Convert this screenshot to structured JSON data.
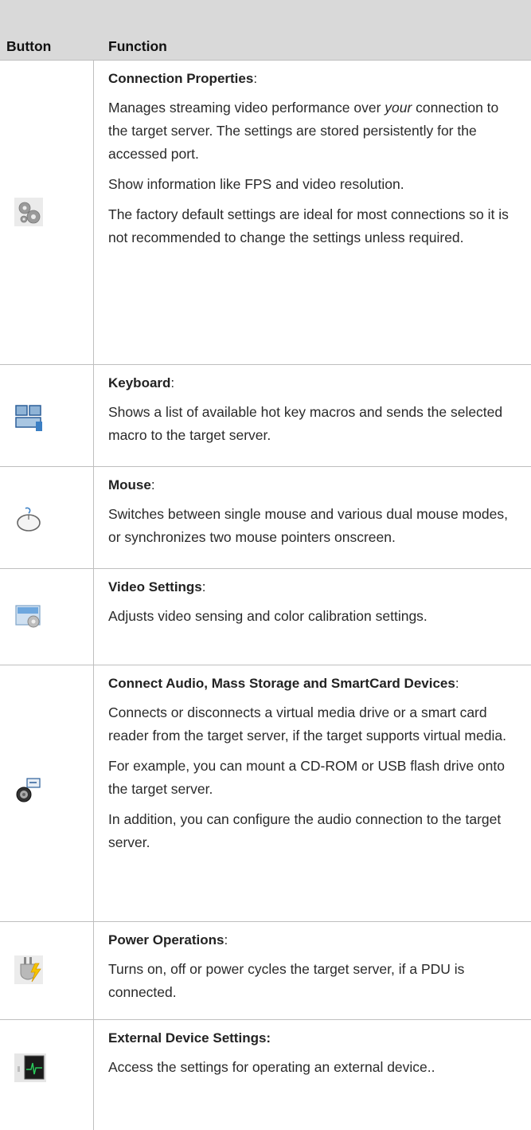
{
  "header": {
    "col_button": "Button",
    "col_function": "Function"
  },
  "rows": [
    {
      "icon": "gears-icon",
      "title": "Connection Properties",
      "title_suffix": ":",
      "p1_pre": "Manages streaming video performance over ",
      "p1_em": "your",
      "p1_post": " connection to the target server. The settings are stored persistently for the accessed port.",
      "p2": "Show information like FPS and video resolution.",
      "p3": "The factory default settings are ideal for most connections so it is not recommended to change the settings unless required."
    },
    {
      "icon": "keyboard-icon",
      "title": "Keyboard",
      "title_suffix": ":",
      "p1": "Shows a list of available hot key macros and sends the selected macro to the target server."
    },
    {
      "icon": "mouse-icon",
      "title": "Mouse",
      "title_suffix": ":",
      "p1": "Switches between single mouse and various dual mouse modes, or synchronizes two mouse pointers onscreen."
    },
    {
      "icon": "video-settings-icon",
      "title": "Video Settings",
      "title_suffix": ":",
      "p1": "Adjusts video sensing and color calibration settings."
    },
    {
      "icon": "virtual-media-icon",
      "title": "Connect Audio, Mass Storage and SmartCard Devices",
      "title_suffix": ":",
      "p1": "Connects or disconnects a virtual media drive or a smart card reader from the target server, if the target supports virtual media.",
      "p2": "For example, you can mount a CD-ROM or USB flash drive onto the target server.",
      "p3": "In addition, you can configure the audio connection to the target server."
    },
    {
      "icon": "power-plug-icon",
      "title": "Power Operations",
      "title_suffix": ":",
      "p1": "Turns on, off or power cycles the target server, if a PDU is connected."
    },
    {
      "icon": "external-device-icon",
      "title": "External Device Settings:",
      "title_suffix": "",
      "p1": "Access the settings for operating an external device.."
    }
  ]
}
